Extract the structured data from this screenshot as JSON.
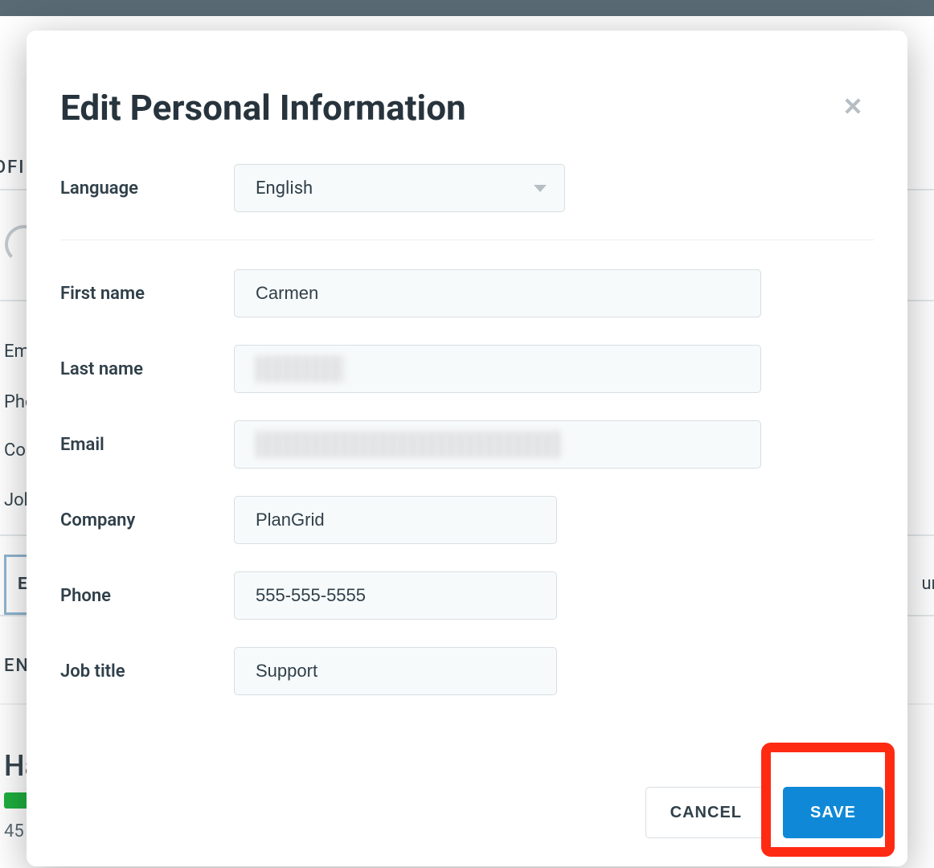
{
  "modal": {
    "title": "Edit Personal Information",
    "language_label": "Language",
    "language_value": "English",
    "first_name_label": "First name",
    "first_name_value": "Carmen",
    "last_name_label": "Last name",
    "email_label": "Email",
    "company_label": "Company",
    "company_value": "PlanGrid",
    "phone_label": "Phone",
    "phone_value": "555-555-5555",
    "job_title_label": "Job title",
    "job_title_value": "Support",
    "cancel_label": "CANCEL",
    "save_label": "SAVE"
  },
  "background": {
    "profile": "OFIL",
    "email": "Em",
    "phone": "Pho",
    "company": "Co",
    "job": "Job",
    "edit": "E",
    "ount": "unt",
    "ens": "ENS",
    "ha": "Ha",
    "remaining": "45"
  }
}
